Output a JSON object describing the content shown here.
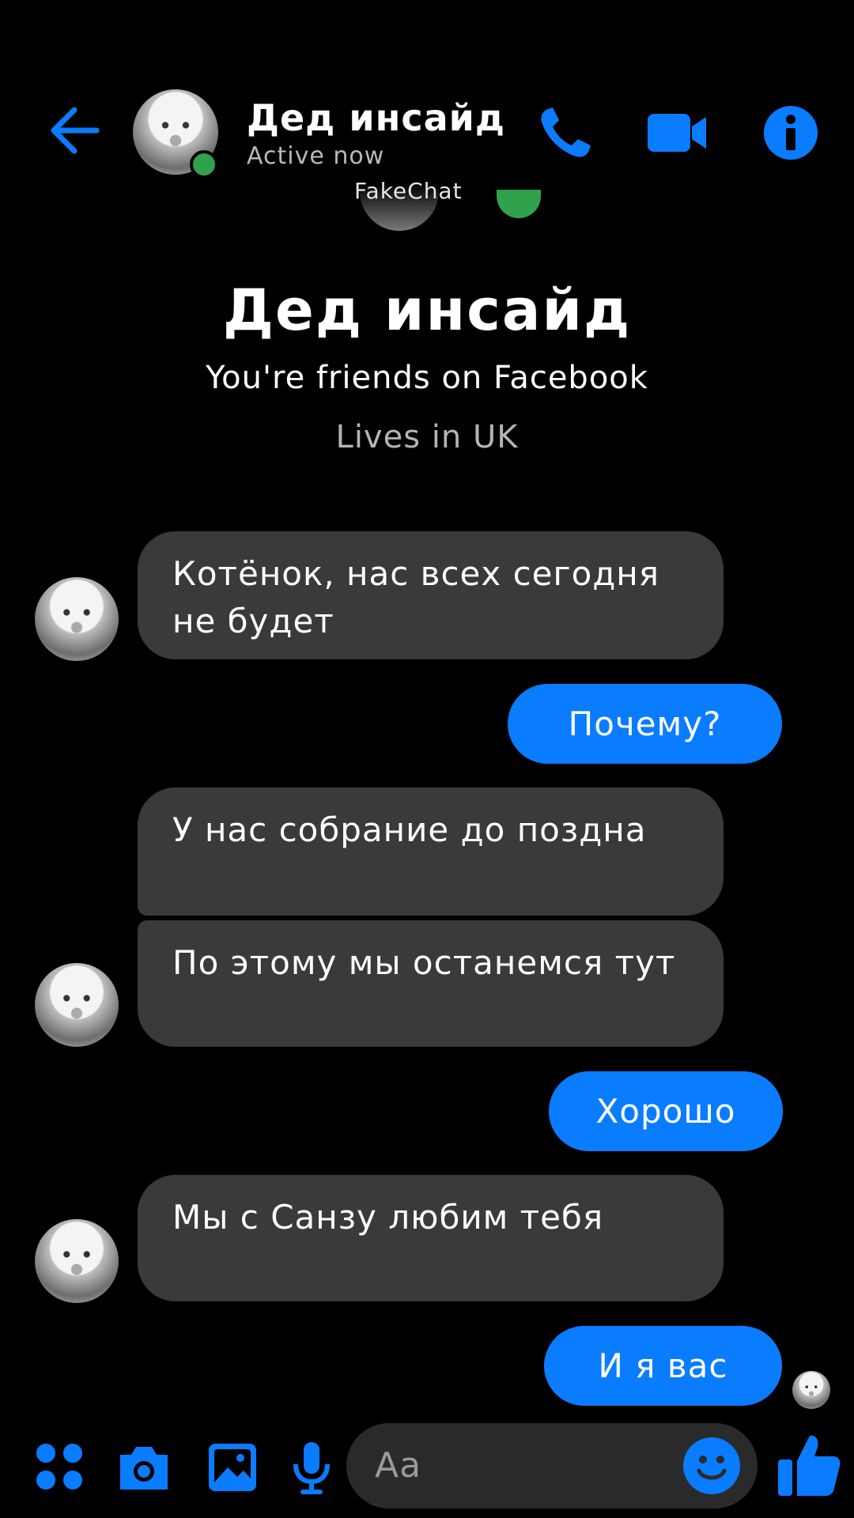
{
  "header": {
    "contact_name": "Дед инсайд",
    "status": "Active now",
    "watermark": "FakeChat"
  },
  "profile": {
    "name": "Дед инсайд",
    "friends_text": "You're friends on Facebook",
    "location_text": "Lives in UK"
  },
  "messages": [
    {
      "from": "them",
      "text": "Котёнок, нас всех сегодня не будет"
    },
    {
      "from": "me",
      "text": "Почему?"
    },
    {
      "from": "them",
      "text": "У нас собрание до позднa"
    },
    {
      "from": "them",
      "text": "По этому мы останемся тут"
    },
    {
      "from": "me",
      "text": "Хорошо"
    },
    {
      "from": "them",
      "text": "Мы с Санзу любим тебя"
    },
    {
      "from": "me",
      "text": "И я вас"
    }
  ],
  "composer": {
    "placeholder": "Aa"
  },
  "colors": {
    "accent": "#0a7cff",
    "incoming_bubble": "#3a3a3c",
    "online": "#31a24c",
    "background": "#000000"
  },
  "icons": {
    "back": "arrow-left-icon",
    "call": "phone-icon",
    "video": "video-camera-icon",
    "info": "info-icon",
    "apps": "apps-grid-icon",
    "camera": "camera-icon",
    "gallery": "image-icon",
    "voice": "microphone-icon",
    "emoji": "emoji-icon",
    "like": "thumbs-up-icon"
  }
}
